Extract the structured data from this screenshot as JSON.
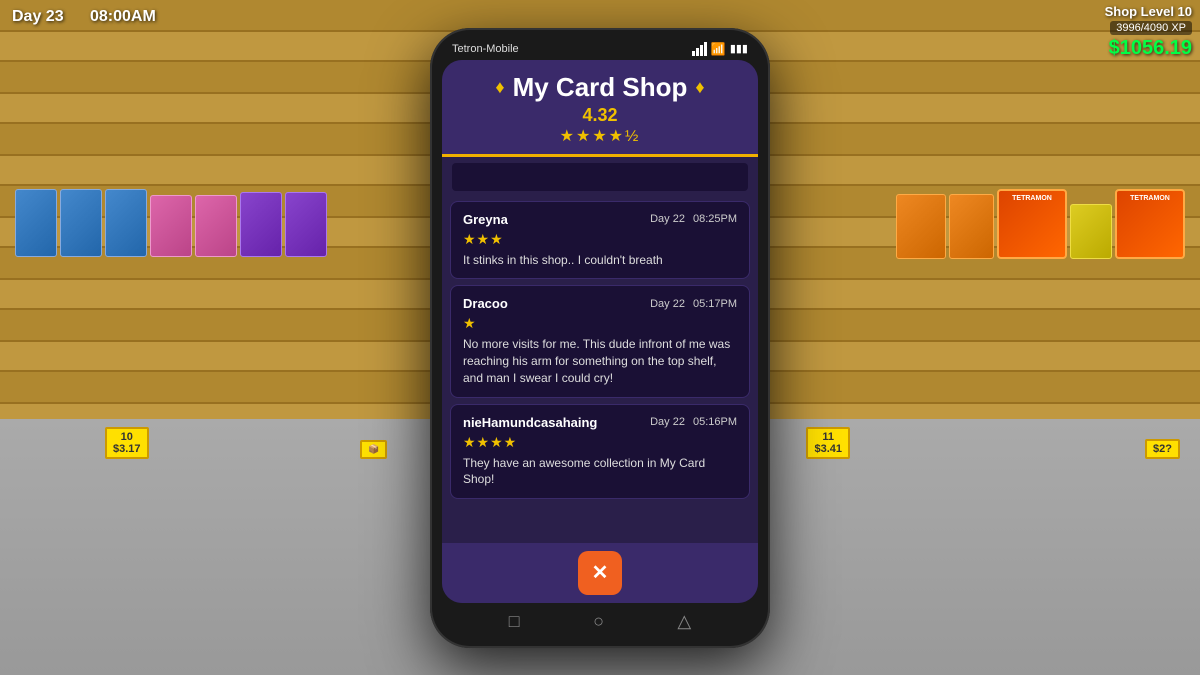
{
  "hud": {
    "day": "Day 23",
    "time": "08:00AM",
    "shop_level": "Shop Level 10",
    "xp": "3996/4090 XP",
    "money": "$1056.19"
  },
  "phone": {
    "carrier": "Tetron-Mobile",
    "app_title": "My Card Shop",
    "rating_value": "4.32",
    "stars": "★★★★½",
    "search_placeholder": ""
  },
  "reviews": [
    {
      "username": "Greyna",
      "day": "Day 22",
      "time": "08:25PM",
      "stars": "★★★",
      "text": "It stinks in this shop.. I couldn't breath"
    },
    {
      "username": "Dracoo",
      "day": "Day 22",
      "time": "05:17PM",
      "stars": "★",
      "text": "No more visits for me. This dude infront of me was reaching his arm for something on the top shelf, and man I swear I could cry!"
    },
    {
      "username": "nieHamundcasahaing",
      "day": "Day 22",
      "time": "05:16PM",
      "stars": "★★★★",
      "text": "They have an awesome collection in My Card Shop!"
    }
  ],
  "price_tags": [
    {
      "count": "10",
      "price": "$3.17"
    },
    {
      "count": "",
      "price": ""
    },
    {
      "count": "11",
      "price": "$3.41"
    },
    {
      "count": "",
      "price": "$2?"
    }
  ],
  "close_button": "✕",
  "nav_icons": [
    "□",
    "○",
    "△"
  ],
  "diamond": "♦"
}
